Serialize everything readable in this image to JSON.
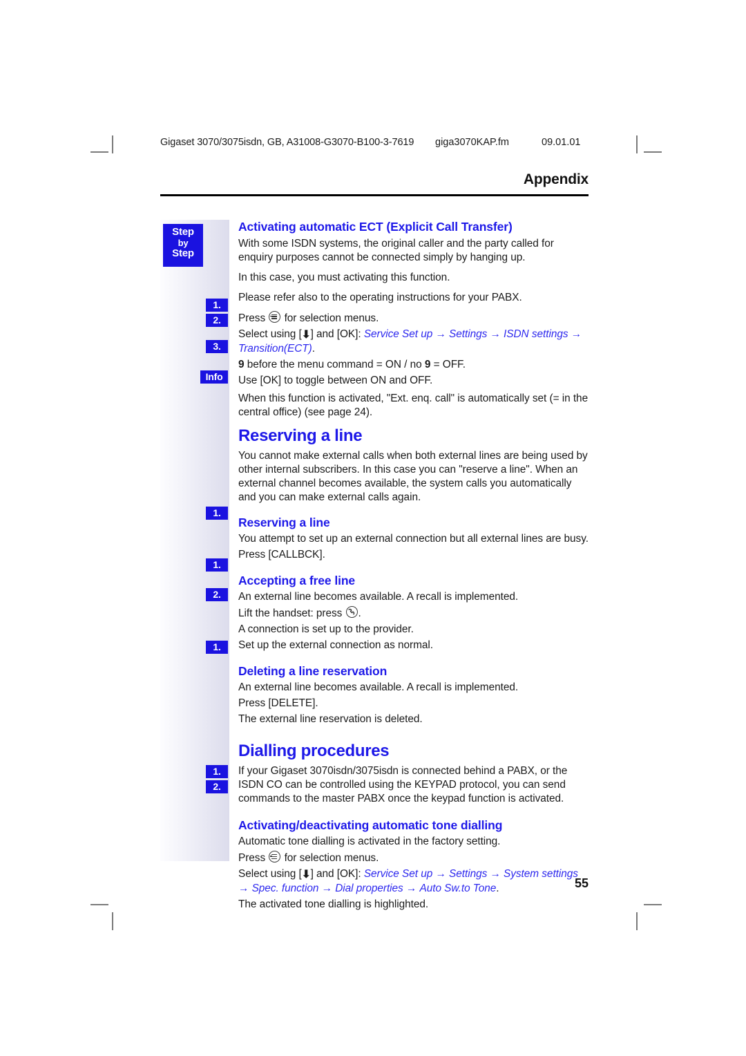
{
  "page": {
    "running_head": "Appendix",
    "page_number": "55",
    "doc_ref": "Gigaset 3070/3075isdn, GB, A31008-G3070-B100-3-7619",
    "doc_file": "giga3070KAP.fm",
    "doc_date": "09.01.01"
  },
  "sidebar": {
    "step_top": "Step",
    "step_mid": "by",
    "step_bottom": "Step",
    "badges": {
      "one": "1.",
      "two": "2.",
      "three": "3.",
      "info": "Info"
    }
  },
  "sections": {
    "ect": {
      "heading": "Activating automatic ECT (Explicit Call Transfer)",
      "p1": "With some ISDN systems, the original caller and the party called for enquiry purposes cannot be connected simply by hanging up.",
      "p2": "In this case, you must activating this function.",
      "p3": "Please refer also to the operating instructions for your PABX.",
      "step1_pre": "Press",
      "step1_post": "for selection menus.",
      "step2_pre": "Select using [",
      "step2_mid": "] and [OK]:",
      "step2_path1": "Service Set up",
      "step2_path2": "Settings",
      "step2_path3": "ISDN settings",
      "step2_path4": "Transition(ECT)",
      "step2_end": ".",
      "step3_line1_a": "9",
      "step3_line1_b": "before the menu command = ON / no",
      "step3_line1_c": "9",
      "step3_line1_d": "= OFF.",
      "step3_line2": "Use [OK] to toggle between ON and OFF.",
      "info_text": "When this function is activated, \"Ext. enq. call\" is automatically set (= in the central office) (see page 24)."
    },
    "reserving": {
      "heading": "Reserving a line",
      "intro": "You cannot make external calls when both external lines are being used by other internal subscribers. In this case you can \"reserve a line\". When an external channel becomes available, the system calls you automatically and you can make external calls again.",
      "sub1_heading": "Reserving a line",
      "sub1_line1": "You attempt to set up an external connection but all external lines are busy.",
      "sub1_step1": "Press [CALLBCK].",
      "sub2_heading": "Accepting a free line",
      "sub2_line1": "An external line becomes available. A recall is implemented.",
      "sub2_step1_pre": "Lift the handset: press",
      "sub2_step1_post": ".",
      "sub2_line2": "A connection is set up to the provider.",
      "sub2_step2": "Set up the external connection as normal.",
      "sub3_heading": "Deleting a line reservation",
      "sub3_line1": "An external line becomes available. A recall is implemented.",
      "sub3_step1": "Press [DELETE].",
      "sub3_line2": "The external line reservation is deleted."
    },
    "dialling": {
      "heading": "Dialling procedures",
      "intro": "If your Gigaset 3070isdn/3075isdn is connected behind a PABX, or the ISDN CO can be controlled using the KEYPAD protocol, you can send commands to the master PABX once the keypad function is activated.",
      "sub_heading": "Activating/deactivating automatic tone dialling",
      "sub_line1": "Automatic tone dialling is activated in the factory setting.",
      "step1_pre": "Press",
      "step1_post": "for selection menus.",
      "step2_pre": "Select using [",
      "step2_mid": "] and [OK]:",
      "step2_path1": "Service Set up",
      "step2_path2": "Settings",
      "step2_path3": "System settings",
      "step2_path4": "Spec. function",
      "step2_path5": "Dial properties",
      "step2_path6": "Auto Sw.to Tone",
      "step2_end": ".",
      "step_after": "The activated tone dialling is highlighted."
    }
  },
  "colors": {
    "heading_blue": "#1d18e8",
    "badge_blue": "#1a12e0",
    "body_text": "#1a1a1a"
  }
}
